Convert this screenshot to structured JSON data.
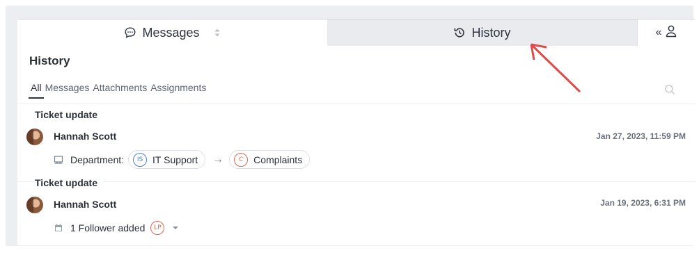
{
  "tabs": {
    "messages_label": "Messages",
    "history_label": "History",
    "user_label": "«"
  },
  "history": {
    "title": "History",
    "filters": [
      "All",
      "Messages",
      "Attachments",
      "Assignments"
    ],
    "active_filter": "All"
  },
  "entries": [
    {
      "group": "Ticket update",
      "author": "Hannah Scott",
      "date": "Jan 27, 2023, 11:59 PM",
      "field_label": "Department:",
      "from": {
        "initials": "IS",
        "label": "IT Support"
      },
      "to": {
        "initials": "C",
        "label": "Complaints"
      }
    },
    {
      "group": "Ticket update",
      "author": "Hannah Scott",
      "date": "Jan 19, 2023, 6:31 PM",
      "follower_text": "1 Follower added",
      "follower_initials": "LP"
    }
  ],
  "colors": {
    "accent_blue": "#4a7fd3",
    "accent_red": "#d86a4e",
    "annotation_arrow": "#e24a4a"
  }
}
